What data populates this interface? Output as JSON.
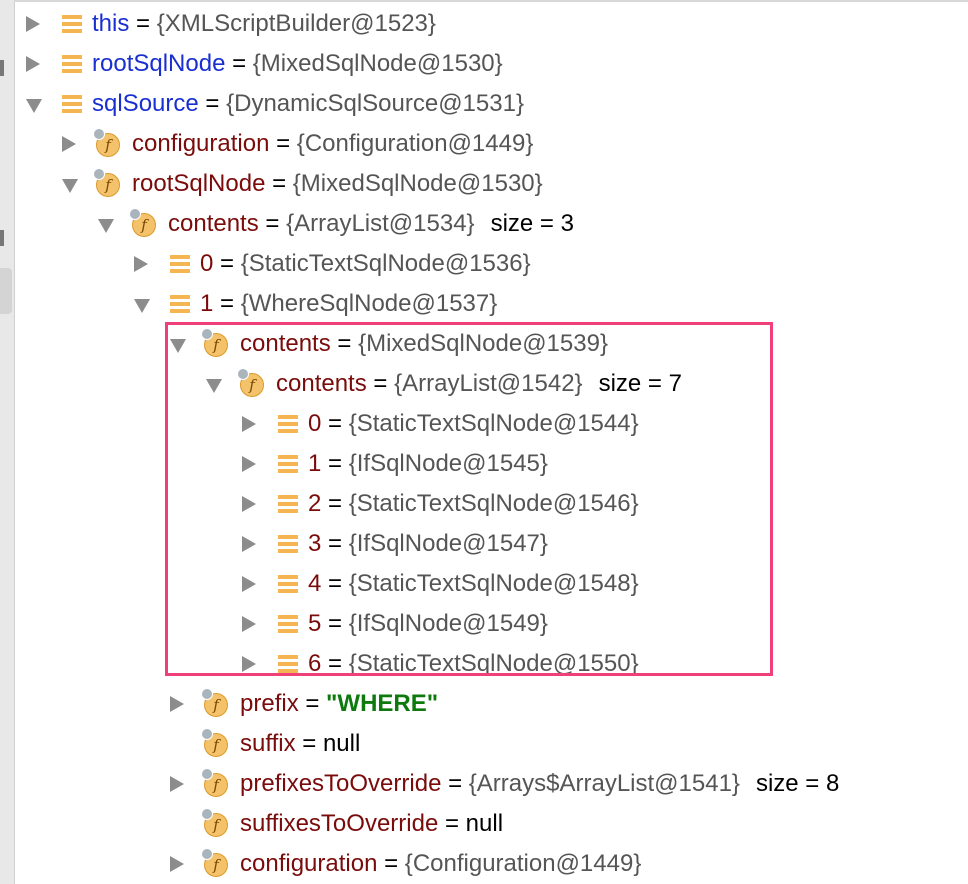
{
  "highlight_color": "#f0407a",
  "nodes": [
    {
      "name": "this",
      "value": "{XMLScriptBuilder@1523}",
      "kind": "list",
      "expand": "right",
      "style": "blue"
    },
    {
      "name": "rootSqlNode",
      "value": "{MixedSqlNode@1530}",
      "kind": "list",
      "expand": "right",
      "style": "blue"
    },
    {
      "name": "sqlSource",
      "value": "{DynamicSqlSource@1531}",
      "kind": "list",
      "expand": "down",
      "style": "blue"
    },
    {
      "name": "configuration",
      "value": "{Configuration@1449}",
      "kind": "field",
      "expand": "right",
      "style": "red"
    },
    {
      "name": "rootSqlNode",
      "value": "{MixedSqlNode@1530}",
      "kind": "field",
      "expand": "down",
      "style": "red"
    },
    {
      "name": "contents",
      "value": "{ArrayList@1534}",
      "extra": "size = 3",
      "kind": "field",
      "expand": "down",
      "style": "red"
    },
    {
      "name": "0",
      "value": "{StaticTextSqlNode@1536}",
      "kind": "list",
      "expand": "right",
      "style": "red"
    },
    {
      "name": "1",
      "value": "{WhereSqlNode@1537}",
      "kind": "list",
      "expand": "down",
      "style": "red"
    },
    {
      "name": "contents",
      "value": "{MixedSqlNode@1539}",
      "kind": "field",
      "expand": "down",
      "style": "red"
    },
    {
      "name": "contents",
      "value": "{ArrayList@1542}",
      "extra": "size = 7",
      "kind": "field",
      "expand": "down",
      "style": "red"
    },
    {
      "name": "0",
      "value": "{StaticTextSqlNode@1544}",
      "kind": "list",
      "expand": "right",
      "style": "red"
    },
    {
      "name": "1",
      "value": "{IfSqlNode@1545}",
      "kind": "list",
      "expand": "right",
      "style": "red"
    },
    {
      "name": "2",
      "value": "{StaticTextSqlNode@1546}",
      "kind": "list",
      "expand": "right",
      "style": "red"
    },
    {
      "name": "3",
      "value": "{IfSqlNode@1547}",
      "kind": "list",
      "expand": "right",
      "style": "red"
    },
    {
      "name": "4",
      "value": "{StaticTextSqlNode@1548}",
      "kind": "list",
      "expand": "right",
      "style": "red"
    },
    {
      "name": "5",
      "value": "{IfSqlNode@1549}",
      "kind": "list",
      "expand": "right",
      "style": "red"
    },
    {
      "name": "6",
      "value": "{StaticTextSqlNode@1550}",
      "kind": "list",
      "expand": "right",
      "style": "red"
    },
    {
      "name": "prefix",
      "value": "\"WHERE\"",
      "kind": "field",
      "expand": "right",
      "style": "red",
      "value_type": "string"
    },
    {
      "name": "suffix",
      "value": "null",
      "kind": "field",
      "expand": "none",
      "style": "red",
      "value_type": "null"
    },
    {
      "name": "prefixesToOverride",
      "value": "{Arrays$ArrayList@1541}",
      "extra": "size = 8",
      "kind": "field",
      "expand": "right",
      "style": "red"
    },
    {
      "name": "suffixesToOverride",
      "value": "null",
      "kind": "field",
      "expand": "none",
      "style": "red",
      "value_type": "null"
    },
    {
      "name": "configuration",
      "value": "{Configuration@1449}",
      "kind": "field",
      "expand": "right",
      "style": "red"
    }
  ]
}
